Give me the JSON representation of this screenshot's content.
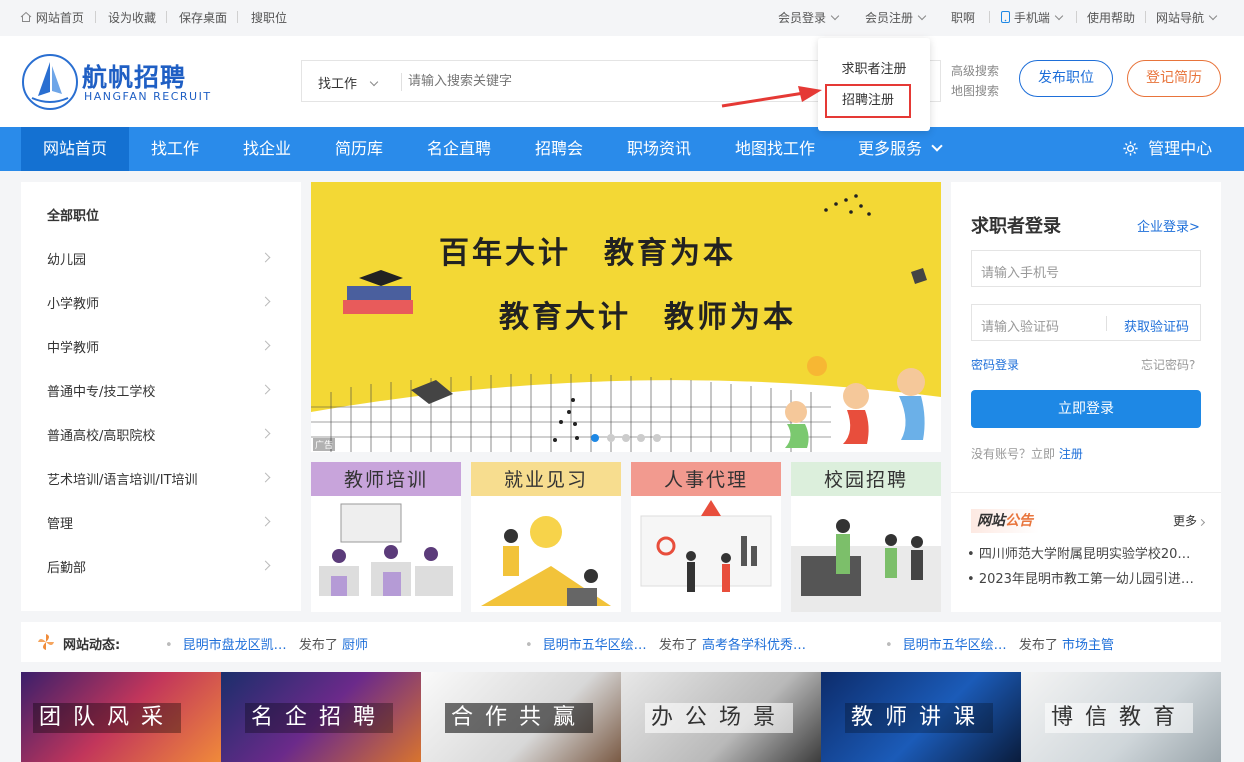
{
  "topbar": {
    "home": "网站首页",
    "favorite": "设为收藏",
    "save_desktop": "保存桌面",
    "search_jobs": "搜职位",
    "member_login": "会员登录",
    "member_register": "会员注册",
    "jobs": "职啊",
    "mobile": "手机端",
    "help": "使用帮助",
    "site_nav": "网站导航"
  },
  "register_dropdown": {
    "jobseeker": "求职者注册",
    "employer": "招聘注册"
  },
  "header": {
    "logo_cn": "航帆招聘",
    "logo_en": "HANGFAN RECRUIT",
    "search_type": "找工作",
    "search_placeholder": "请输入搜索关键字",
    "advanced_search": "高级搜索",
    "map_search": "地图搜索",
    "post_job": "发布职位",
    "register_resume": "登记简历"
  },
  "nav": {
    "items": [
      "网站首页",
      "找工作",
      "找企业",
      "简历库",
      "名企直聘",
      "招聘会",
      "职场资讯",
      "地图找工作",
      "更多服务"
    ],
    "admin": "管理中心"
  },
  "sidebar": {
    "header": "全部职位",
    "items": [
      "幼儿园",
      "小学教师",
      "中学教师",
      "普通中专/技工学校",
      "普通高校/高职院校",
      "艺术培训/语言培训/IT培训",
      "管理",
      "后勤部"
    ]
  },
  "banner": {
    "line1": "百年大计　教育为本",
    "line2": "教育大计　教师为本",
    "ad_tag": "广告",
    "slide_count": 5,
    "active_slide": 0
  },
  "cards": [
    {
      "title": "教师培训",
      "color": "#c8a4db"
    },
    {
      "title": "就业见习",
      "color": "#f7dd8f"
    },
    {
      "title": "人事代理",
      "color": "#f29a8f"
    },
    {
      "title": "校园招聘",
      "color": "#dcefdc"
    }
  ],
  "login": {
    "title": "求职者登录",
    "company_login": "企业登录>",
    "phone_placeholder": "请输入手机号",
    "code_placeholder": "请输入验证码",
    "get_code": "获取验证码",
    "password_login": "密码登录",
    "forgot": "忘记密码?",
    "submit": "立即登录",
    "no_account": "没有账号？立即",
    "register": "注册"
  },
  "notice": {
    "title_a": "网站",
    "title_b": "公告",
    "more": "更多",
    "items": [
      "四川师范大学附属昆明实验学校20…",
      "2023年昆明市教工第一幼儿园引进…"
    ]
  },
  "dynamics": {
    "label": "网站动态:",
    "entries": [
      {
        "who": "昆明市盘龙区凯…",
        "verb": "发布了",
        "job": "厨师"
      },
      {
        "who": "昆明市五华区绘…",
        "verb": "发布了",
        "job": "高考各学科优秀…"
      },
      {
        "who": "昆明市五华区绘…",
        "verb": "发布了",
        "job": "市场主管"
      }
    ]
  },
  "tiles": [
    "团队风采",
    "名企招聘",
    "合作共赢",
    "办公场景",
    "教师讲课",
    "博信教育"
  ],
  "colors": {
    "primary": "#2a8bea",
    "nav_active": "#1471d2",
    "accent_orange": "#e8743b",
    "highlight_red": "#e53935"
  }
}
